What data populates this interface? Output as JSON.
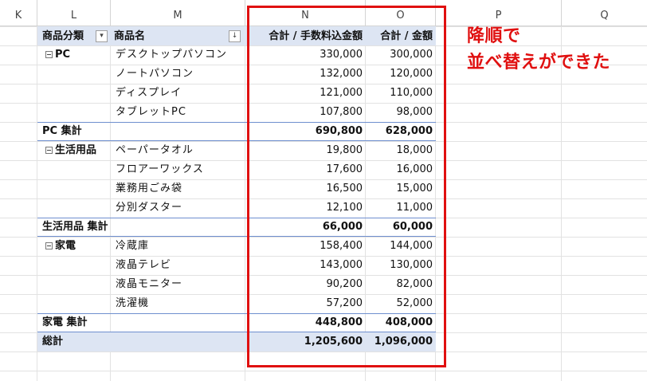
{
  "columns": [
    "K",
    "L",
    "M",
    "N",
    "O",
    "P",
    "Q"
  ],
  "pivot": {
    "header": {
      "category": "商品分類",
      "product": "商品名",
      "sum_fee": "合計 / 手数料込金額",
      "sum_amount": "合計 / 金額"
    },
    "groups": [
      {
        "name": "PC",
        "items": [
          {
            "name": "デスクトップパソコン",
            "fee": "330,000",
            "amount": "300,000"
          },
          {
            "name": "ノートパソコン",
            "fee": "132,000",
            "amount": "120,000"
          },
          {
            "name": "ディスプレイ",
            "fee": "121,000",
            "amount": "110,000"
          },
          {
            "name": "タブレットPC",
            "fee": "107,800",
            "amount": "98,000"
          }
        ],
        "subtotal_label": "PC 集計",
        "subtotal_fee": "690,800",
        "subtotal_amount": "628,000"
      },
      {
        "name": "生活用品",
        "items": [
          {
            "name": "ペーパータオル",
            "fee": "19,800",
            "amount": "18,000"
          },
          {
            "name": "フロアーワックス",
            "fee": "17,600",
            "amount": "16,000"
          },
          {
            "name": "業務用ごみ袋",
            "fee": "16,500",
            "amount": "15,000"
          },
          {
            "name": "分別ダスター",
            "fee": "12,100",
            "amount": "11,000"
          }
        ],
        "subtotal_label": "生活用品 集計",
        "subtotal_fee": "66,000",
        "subtotal_amount": "60,000"
      },
      {
        "name": "家電",
        "items": [
          {
            "name": "冷蔵庫",
            "fee": "158,400",
            "amount": "144,000"
          },
          {
            "name": "液晶テレビ",
            "fee": "143,000",
            "amount": "130,000"
          },
          {
            "name": "液晶モニター",
            "fee": "90,200",
            "amount": "82,000"
          },
          {
            "name": "洗濯機",
            "fee": "57,200",
            "amount": "52,000"
          }
        ],
        "subtotal_label": "家電 集計",
        "subtotal_fee": "448,800",
        "subtotal_amount": "408,000"
      }
    ],
    "grand_total": {
      "label": "総計",
      "fee": "1,205,600",
      "amount": "1,096,000"
    }
  },
  "annotation": {
    "line1": "降順で",
    "line2": "並べ替えができた"
  },
  "colors": {
    "highlight": "#e01010",
    "pivot_header": "#dde5f3",
    "pivot_line": "#6f8fcf"
  }
}
